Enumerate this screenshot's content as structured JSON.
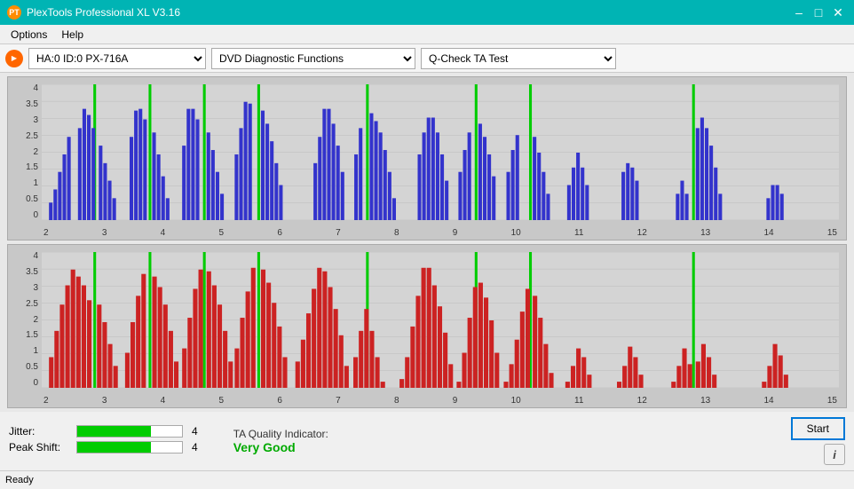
{
  "titleBar": {
    "title": "PlexTools Professional XL V3.16",
    "icon": "PT",
    "minimizeLabel": "–",
    "maximizeLabel": "□",
    "closeLabel": "✕"
  },
  "menuBar": {
    "items": [
      "Options",
      "Help"
    ]
  },
  "toolbar": {
    "driveValue": "HA:0 ID:0  PX-716A",
    "functionValue": "DVD Diagnostic Functions",
    "testValue": "Q-Check TA Test"
  },
  "charts": {
    "top": {
      "yLabels": [
        "4",
        "3.5",
        "3",
        "2.5",
        "2",
        "1.5",
        "1",
        "0.5",
        "0"
      ],
      "xLabels": [
        "2",
        "3",
        "4",
        "5",
        "6",
        "7",
        "8",
        "9",
        "10",
        "11",
        "12",
        "13",
        "14",
        "15"
      ]
    },
    "bottom": {
      "yLabels": [
        "4",
        "3.5",
        "3",
        "2.5",
        "2",
        "1.5",
        "1",
        "0.5",
        "0"
      ],
      "xLabels": [
        "2",
        "3",
        "4",
        "5",
        "6",
        "7",
        "8",
        "9",
        "10",
        "11",
        "12",
        "13",
        "14",
        "15"
      ]
    }
  },
  "metrics": {
    "jitter": {
      "label": "Jitter:",
      "value": "4",
      "filledSegments": 7,
      "totalSegments": 10
    },
    "peakShift": {
      "label": "Peak Shift:",
      "value": "4",
      "filledSegments": 7,
      "totalSegments": 10
    },
    "taQuality": {
      "label": "TA Quality Indicator:",
      "value": "Very Good"
    }
  },
  "buttons": {
    "start": "Start",
    "info": "i"
  },
  "statusBar": {
    "status": "Ready"
  }
}
